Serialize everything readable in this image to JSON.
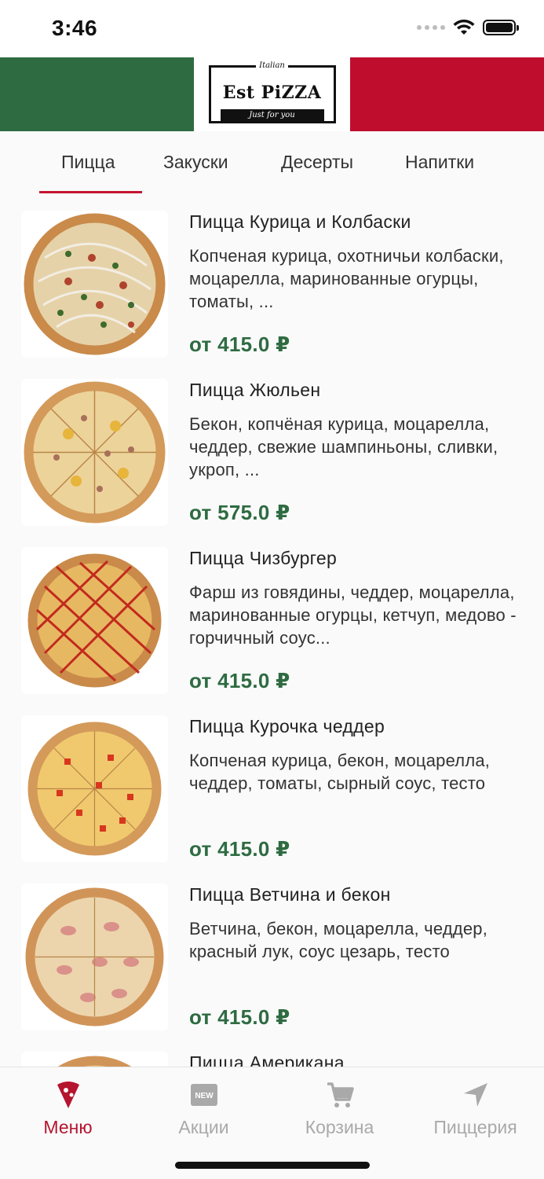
{
  "status_bar": {
    "time": "3:46",
    "icons": [
      "signal-icon",
      "wifi-icon",
      "battery-icon"
    ]
  },
  "header": {
    "logo": {
      "top_text": "Italian",
      "main_text": "Est PiZZA",
      "sub_text": "Just for you"
    },
    "colors": {
      "green": "#2e6b41",
      "white": "#ffffff",
      "red": "#bf0d2e"
    }
  },
  "tabs": [
    {
      "label": "Пицца",
      "active": true
    },
    {
      "label": "Закуски",
      "active": false
    },
    {
      "label": "Десерты",
      "active": false
    },
    {
      "label": "Напитки",
      "active": false
    }
  ],
  "menu": [
    {
      "title": "Пицца Курица и Колбаски",
      "description": "Копченая курица, охотничьи колбаски, моцарелла, маринованные огурцы, томаты, ...",
      "price": "от 415.0 ₽",
      "image": "pizza-chicken-sausage"
    },
    {
      "title": "Пицца Жюльен",
      "description": "Бекон, копчёная курица, моцарелла, чеддер, свежие шампиньоны, сливки, укроп, ...",
      "price": "от 575.0 ₽",
      "image": "pizza-julienne"
    },
    {
      "title": "Пицца Чизбургер",
      "description": "Фарш из говядины, чеддер, моцарелла, маринованные огурцы, кетчуп, медово - горчичный соус...",
      "price": "от 415.0 ₽",
      "image": "pizza-cheeseburger"
    },
    {
      "title": "Пицца Курочка чеддер",
      "description": "Копченая курица, бекон, моцарелла, чеддер, томаты, сырный соус, тесто",
      "price": "от 415.0 ₽",
      "image": "pizza-chicken-cheddar"
    },
    {
      "title": "Пицца Ветчина и бекон",
      "description": "Ветчина, бекон, моцарелла, чеддер, красный лук, соус цезарь, тесто",
      "price": "от 415.0 ₽",
      "image": "pizza-ham-bacon"
    },
    {
      "title": "Пицца Американа",
      "description": "",
      "price": "",
      "image": "pizza-americana"
    }
  ],
  "bottom_nav": [
    {
      "label": "Меню",
      "icon": "pizza-slice-icon",
      "active": true
    },
    {
      "label": "Акции",
      "icon": "new-badge-icon",
      "active": false
    },
    {
      "label": "Корзина",
      "icon": "cart-icon",
      "active": false
    },
    {
      "label": "Пиццерия",
      "icon": "location-arrow-icon",
      "active": false
    }
  ],
  "colors": {
    "accent": "#b5152f",
    "price": "#2e6b41",
    "inactive": "#a9a9a9"
  }
}
